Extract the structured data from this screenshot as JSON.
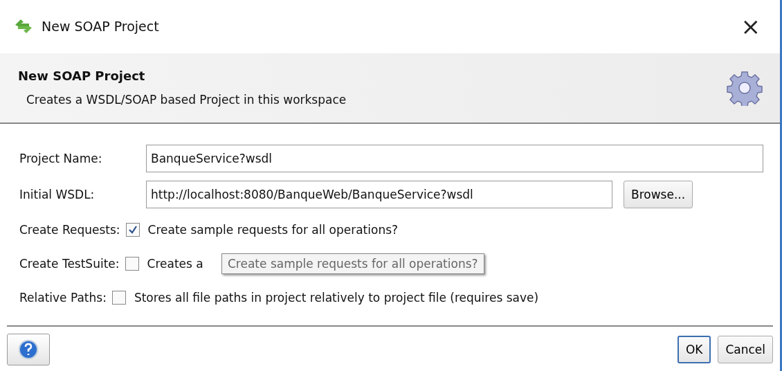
{
  "window": {
    "title": "New SOAP Project",
    "close": "×"
  },
  "header": {
    "title": "New SOAP Project",
    "subtitle": "Creates a WSDL/SOAP based Project in this workspace"
  },
  "fields": [
    {
      "label": "Project Name:",
      "value": "BanqueService?wsdl"
    },
    {
      "label": "Initial WSDL:",
      "value": "http://localhost:8080/BanqueWeb/BanqueService?wsdl",
      "button": "Browse..."
    }
  ],
  "options": [
    {
      "label": "Create Requests:",
      "text": "Create sample requests for all operations?",
      "checked": true
    },
    {
      "label": "Create TestSuite:",
      "text": "Creates a",
      "checked": false
    },
    {
      "label": "Relative Paths:",
      "text": "Stores all file paths in project relatively to project file (requires save)",
      "checked": false
    }
  ],
  "tooltip": {
    "text": "Create sample requests for all operations?"
  },
  "buttons": [
    {
      "label": "OK",
      "selected": true
    },
    {
      "label": "Cancel",
      "selected": false
    }
  ]
}
